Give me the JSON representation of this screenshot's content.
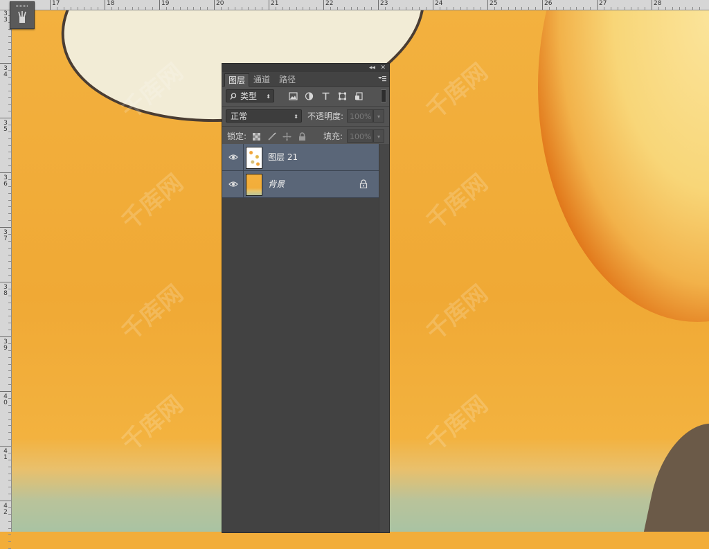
{
  "ruler": {
    "top_labels": [
      "17",
      "18",
      "19",
      "20",
      "21",
      "22",
      "23",
      "24",
      "25",
      "26",
      "27",
      "28"
    ],
    "left_labels": [
      "3",
      "3",
      "3",
      "4",
      "3",
      "5",
      "3",
      "6",
      "3",
      "7",
      "3",
      "8",
      "3",
      "9",
      "4",
      "0",
      "4",
      "1",
      "4",
      "2"
    ]
  },
  "watermark_text": "千库网",
  "panel": {
    "tabs": [
      {
        "label": "图层",
        "active": true
      },
      {
        "label": "通道",
        "active": false
      },
      {
        "label": "路径",
        "active": false
      }
    ],
    "collapse_glyph": "◂◂",
    "close_glyph": "✕",
    "filter": {
      "label": "类型"
    },
    "blend_mode": "正常",
    "opacity_label": "不透明度:",
    "opacity_value": "100%",
    "lock_label": "锁定:",
    "fill_label": "填充:",
    "fill_value": "100%",
    "layers": [
      {
        "name": "图层 21",
        "visible": true,
        "locked": false,
        "italic": false
      },
      {
        "name": "背景",
        "visible": true,
        "locked": true,
        "italic": true
      }
    ]
  },
  "colors": {
    "canvas_orange": "#f2ad3a",
    "panel_bg": "#535353",
    "layer_selected": "#5a6678"
  }
}
